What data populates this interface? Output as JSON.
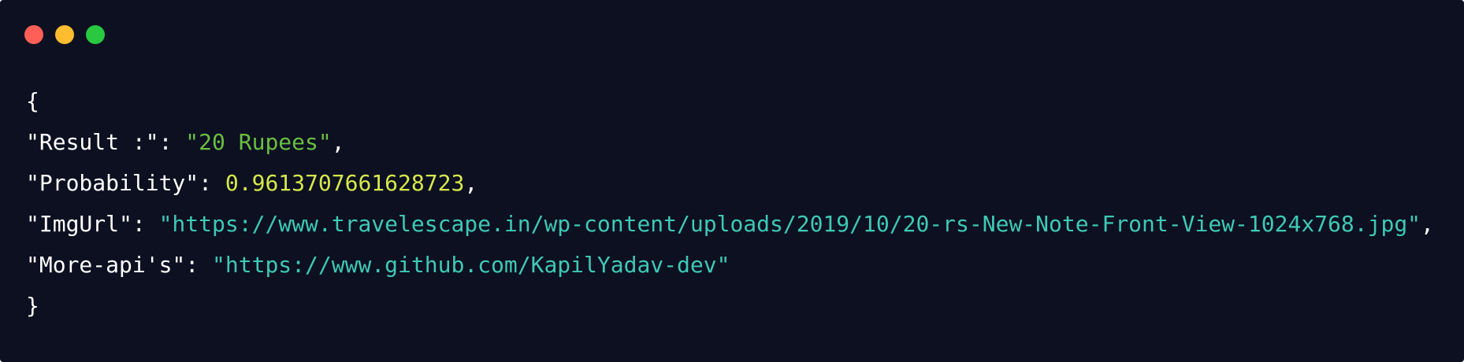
{
  "window": {
    "controls": {
      "close_color": "#ff5f57",
      "minimize_color": "#febc2e",
      "zoom_color": "#28c840"
    }
  },
  "colors": {
    "background": "#0c1021",
    "text": "#ffffff",
    "string_green": "#6abf40",
    "number_yellow": "#d7e84a",
    "string_teal": "#3ec9b5"
  },
  "code": {
    "open_brace": "{",
    "close_brace": "}",
    "lines": [
      {
        "key": "\"Result :\"",
        "value": "\"20 Rupees\"",
        "value_type": "string",
        "trailer": ","
      },
      {
        "key": "\"Probability\"",
        "value": "0.9613707661628723",
        "value_type": "number",
        "trailer": ","
      },
      {
        "key": "\"ImgUrl\"",
        "value": "\"https://www.travelescape.in/wp-content/uploads/2019/10/20-rs-New-Note-Front-View-1024x768.jpg\"",
        "value_type": "url",
        "trailer": ","
      },
      {
        "key": "\"More-api's\"",
        "value": "\"https://www.github.com/KapilYadav-dev\"",
        "value_type": "url",
        "trailer": ""
      }
    ]
  }
}
